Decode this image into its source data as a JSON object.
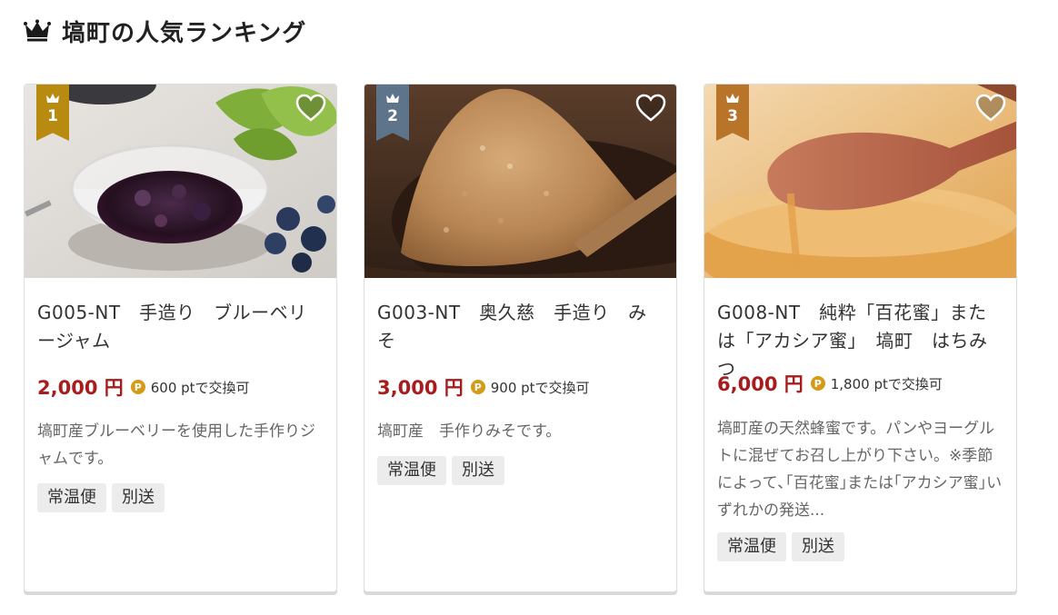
{
  "section": {
    "title": "塙町の人気ランキング",
    "icon": "crown-icon"
  },
  "colors": {
    "price": "#a71c1c",
    "rank1": "#b88b10",
    "rank2": "#5d748a",
    "rank3": "#b87428",
    "point": "#d49a18"
  },
  "products": [
    {
      "rank": "1",
      "title": "G005-NT　手造り　ブルーベリージャム",
      "price": "2,000 円",
      "point_icon": "P",
      "points": "600 ptで交換可",
      "description": "塙町産ブルーベリーを使用した手作りジャムです。",
      "tags": [
        "常温便",
        "別送"
      ],
      "image": "blueberry-jam-photo"
    },
    {
      "rank": "2",
      "title": "G003-NT　奥久慈　手造り　みそ",
      "price": "3,000 円",
      "point_icon": "P",
      "points": "900 ptで交換可",
      "description": "塙町産　手作りみそです。",
      "tags": [
        "常温便",
        "別送"
      ],
      "image": "miso-photo"
    },
    {
      "rank": "3",
      "title": "G008-NT　純粋「百花蜜」または「アカシア蜜」　塙町　はちみつ",
      "price": "6,000 円",
      "point_icon": "P",
      "points": "1,800 ptで交換可",
      "description": "塙町産の天然蜂蜜です。パンやヨーグルトに混ぜてお召し上がり下さい。※季節によって､｢百花蜜｣または｢アカシア蜜｣いずれかの発送...",
      "tags": [
        "常温便",
        "別送"
      ],
      "image": "honey-photo"
    }
  ]
}
